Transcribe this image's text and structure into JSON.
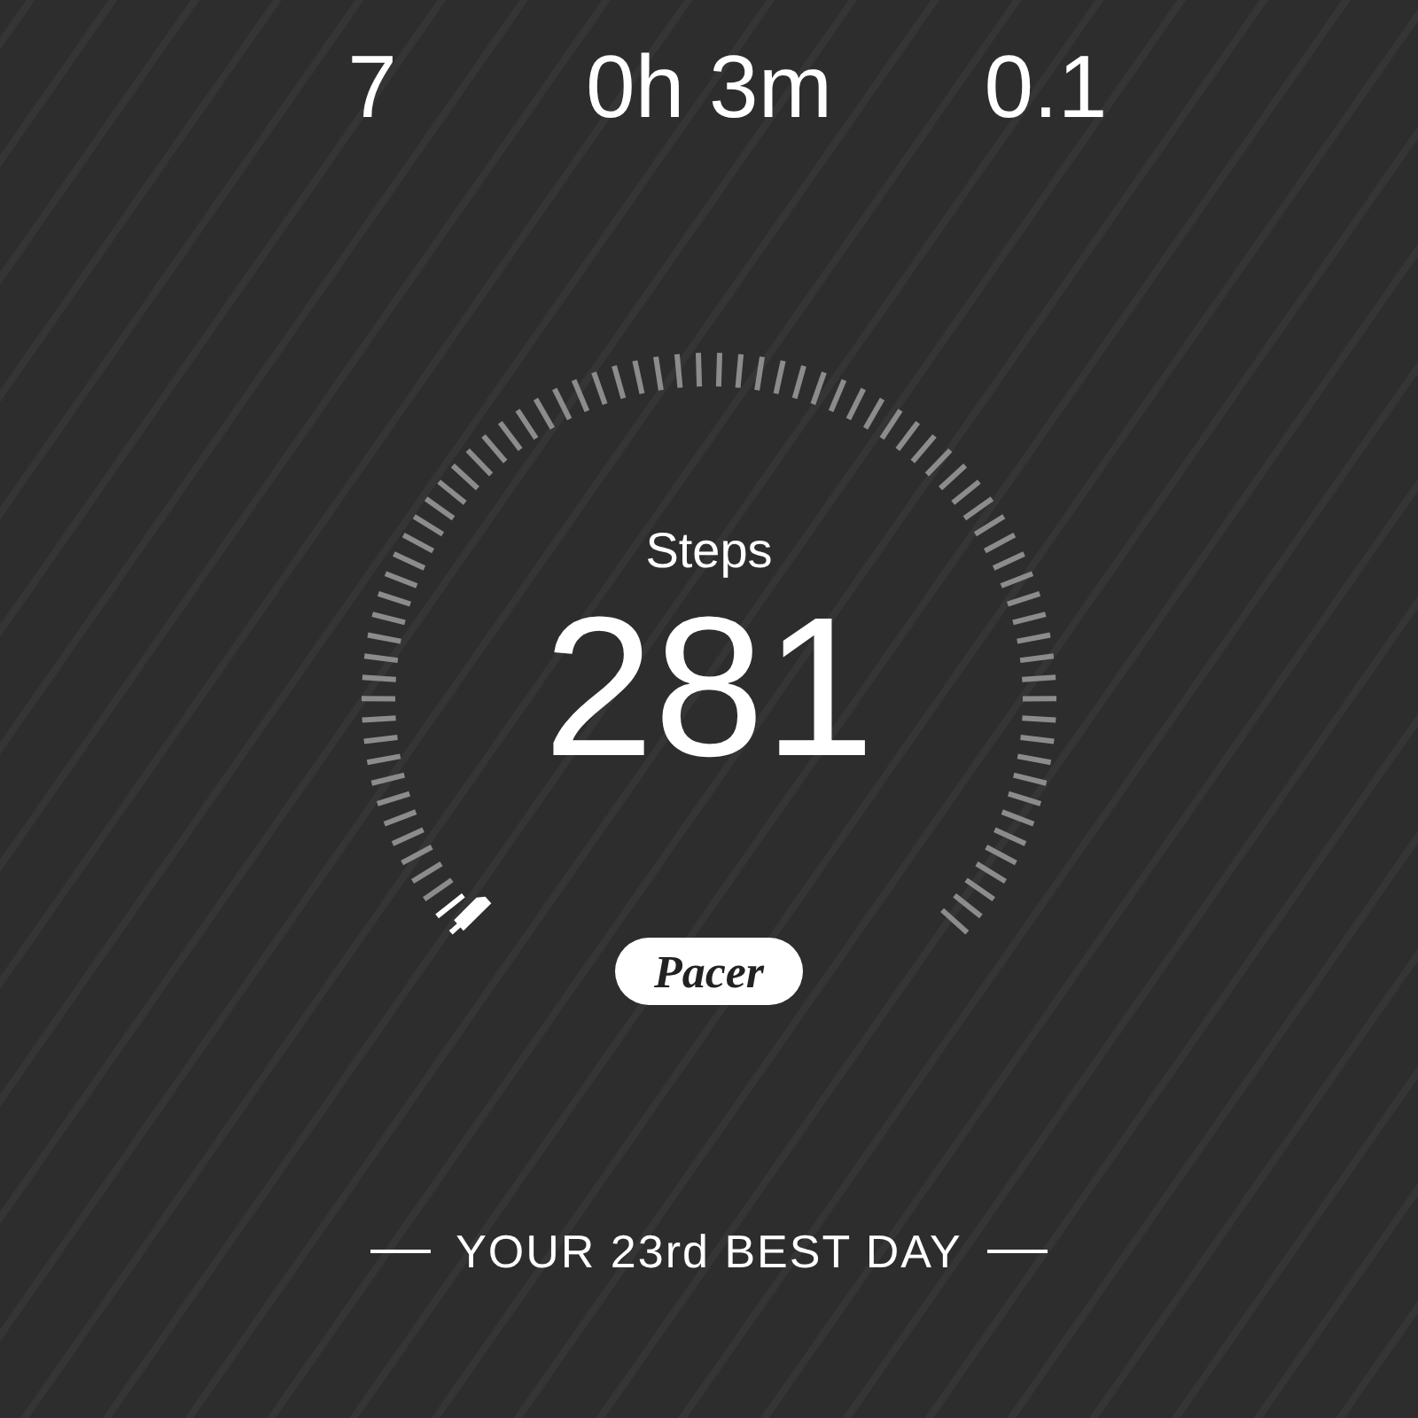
{
  "stats": [
    {
      "value": "7"
    },
    {
      "value": "0h 3m"
    },
    {
      "value": "0.1"
    }
  ],
  "gauge": {
    "label": "Steps",
    "value": "281"
  },
  "badge": "Pacer",
  "footer": "YOUR 23rd BEST DAY"
}
